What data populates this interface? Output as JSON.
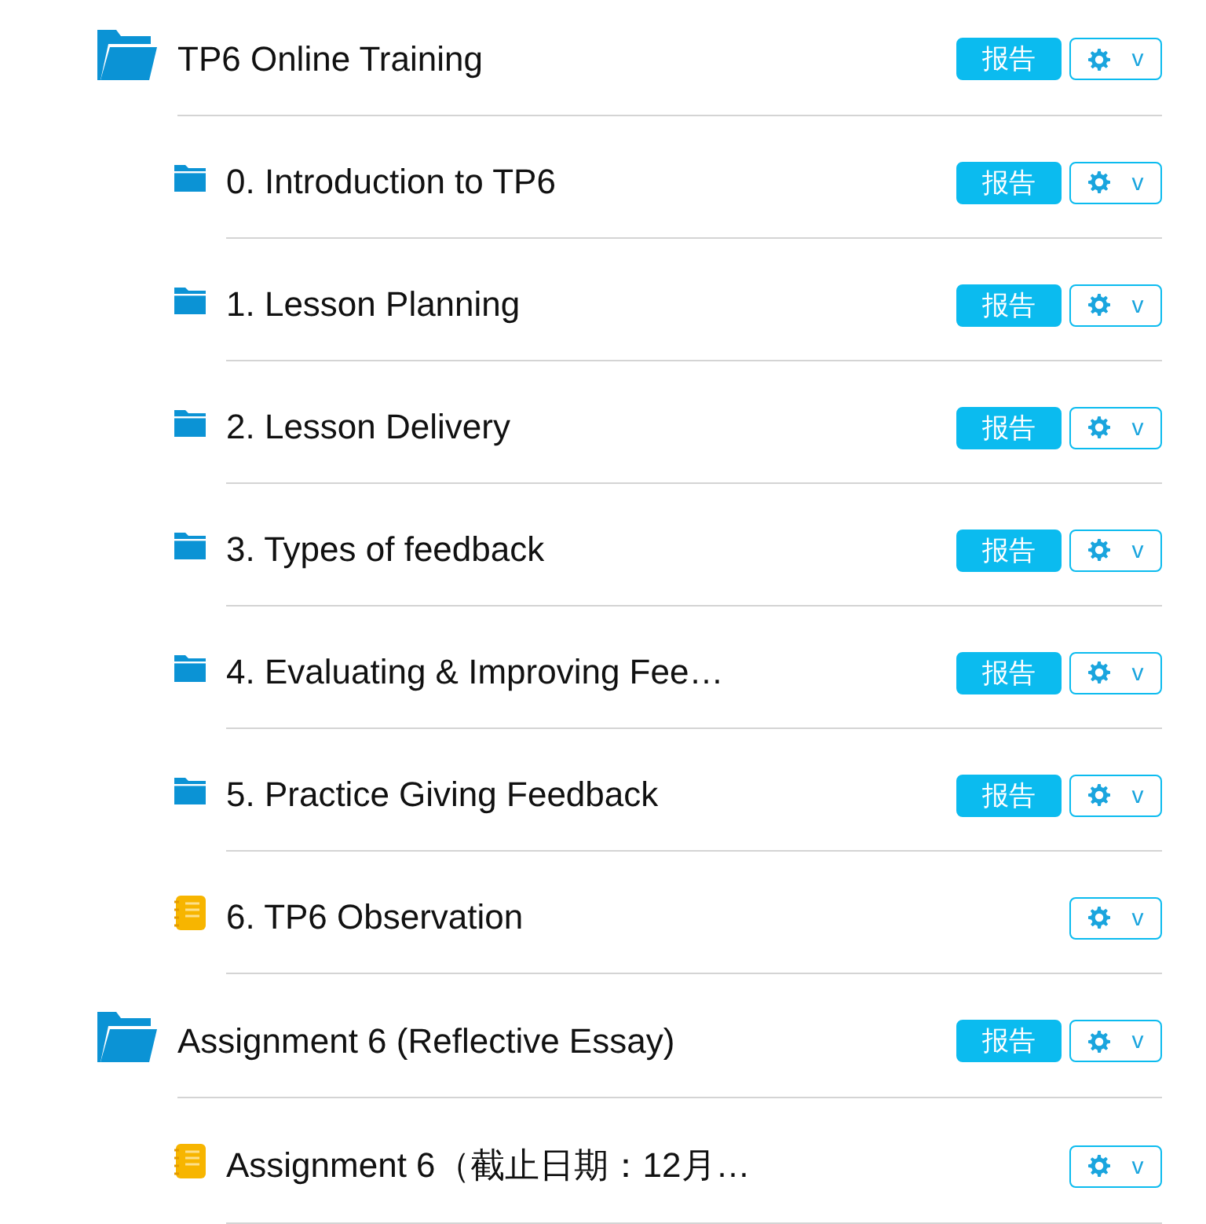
{
  "items": [
    {
      "kind": "folder",
      "title": "TP6 Online Training",
      "report": "报告",
      "menu_caret": "v",
      "children": [
        {
          "kind": "folder",
          "title": "0. Introduction to TP6",
          "report": "报告",
          "menu_caret": "v"
        },
        {
          "kind": "folder",
          "title": "1. Lesson Planning",
          "report": "报告",
          "menu_caret": "v"
        },
        {
          "kind": "folder",
          "title": "2. Lesson Delivery",
          "report": "报告",
          "menu_caret": "v"
        },
        {
          "kind": "folder",
          "title": "3. Types of feedback",
          "report": "报告",
          "menu_caret": "v"
        },
        {
          "kind": "folder",
          "title": "4. Evaluating & Improving Fee…",
          "report": "报告",
          "menu_caret": "v"
        },
        {
          "kind": "folder",
          "title": "5. Practice Giving Feedback",
          "report": "报告",
          "menu_caret": "v"
        },
        {
          "kind": "assignment",
          "title": "6. TP6 Observation",
          "menu_caret": "v"
        }
      ]
    },
    {
      "kind": "folder",
      "title": "Assignment 6 (Reflective Essay)",
      "report": "报告",
      "menu_caret": "v",
      "children": [
        {
          "kind": "assignment",
          "title": "Assignment 6（截止日期：12月…",
          "menu_caret": "v"
        }
      ]
    }
  ]
}
